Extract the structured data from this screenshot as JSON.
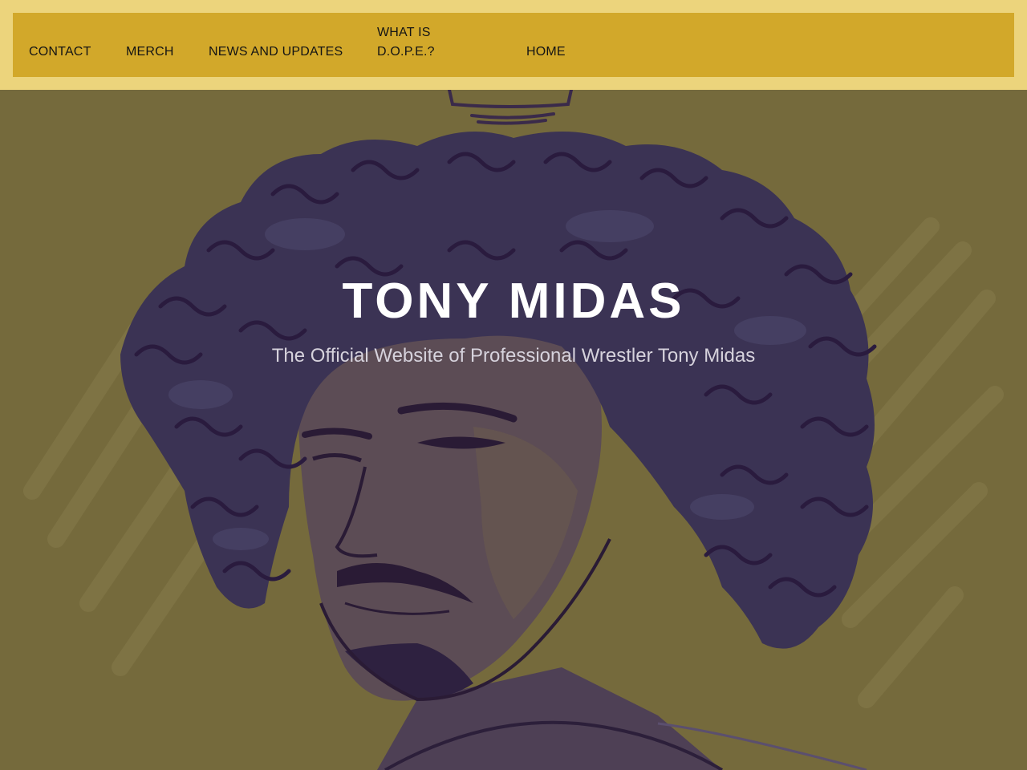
{
  "nav": {
    "items": [
      {
        "label": "CONTACT"
      },
      {
        "label": "MERCH"
      },
      {
        "label": "NEWS AND UPDATES"
      },
      {
        "label": "WHAT IS D.O.P.E.?"
      },
      {
        "label": "HOME"
      }
    ]
  },
  "hero": {
    "title": "TONY MIDAS",
    "subtitle": "The Official Website of Professional Wrestler Tony Midas",
    "image": "illustrated-portrait-with-crown"
  },
  "colors": {
    "header_outer": "#ecd47c",
    "header_inner": "#d2a82a",
    "hero_background": "#756a3c",
    "hair": "#3b3354",
    "skin": "#5a4a52",
    "title_text": "#ffffff",
    "subtitle_text": "#d6d2dc"
  }
}
